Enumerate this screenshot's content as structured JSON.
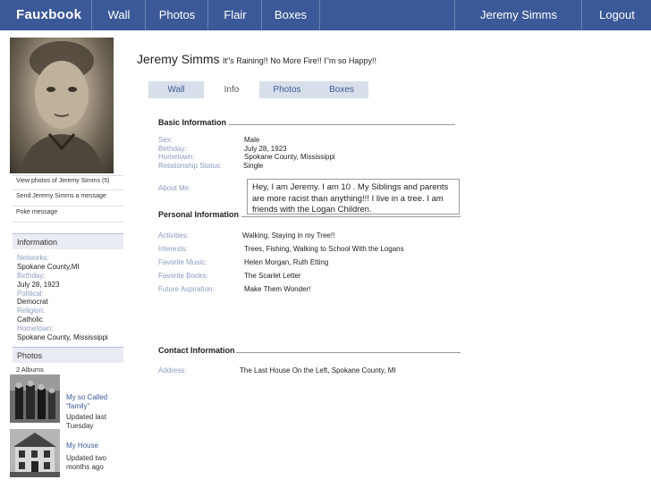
{
  "nav": {
    "brand": "Fauxbook",
    "items": [
      "Wall",
      "Photos",
      "Flair",
      "Boxes"
    ],
    "user": "Jeremy Simms",
    "logout": "Logout"
  },
  "profile": {
    "name": "Jeremy Simms",
    "status": "It\"s Raining!! No More Fire!! I\"m so Happy!!"
  },
  "tabs": [
    "Wall",
    "Info",
    "Photos",
    "Boxes"
  ],
  "active_tab": "Info",
  "left": {
    "actions": [
      "View photos of Jeremy Simms (5)",
      "Send Jeremy Simms a message",
      "Poke message"
    ],
    "information": {
      "header": "Information",
      "fields": [
        {
          "key": "Networks:",
          "value": "Spokane County,MI"
        },
        {
          "key": "Birthday:",
          "value": "July 28, 1923"
        },
        {
          "key": "Political:",
          "value": "Democrat"
        },
        {
          "key": "Religion:",
          "value": "Catholic"
        },
        {
          "key": "Hometown:",
          "value": "Spokane County, Mississippi"
        }
      ]
    },
    "photos": {
      "header": "Photos",
      "count": "2 Albums",
      "albums": [
        {
          "title": "My so Called “family”",
          "updated": "Updated last Tuesday"
        },
        {
          "title": "My House",
          "updated": "Updated two months ago"
        }
      ]
    }
  },
  "basic": {
    "header": "Basic Information",
    "fields": [
      {
        "key": "Sex:",
        "value": "Male"
      },
      {
        "key": "Birthday:",
        "value": "July 28, 1923"
      },
      {
        "key": "Hometown:",
        "value": "Spokane County, Mississippi"
      },
      {
        "key": "Relationship Status:",
        "value": "Single"
      }
    ],
    "about_key": "About Me:",
    "about_value": "Hey, I am Jeremy. I am 10 . My Siblings and parents are more racist than anything!!! I live in a tree. I am friends with the Logan Children."
  },
  "personal": {
    "header": "Personal Information",
    "fields": [
      {
        "key": "Activities:",
        "value": "Walking, Staying in my Tree!!"
      },
      {
        "key": "Interests:",
        "value": "Trees, Fishing, Walking to School With the Logans"
      },
      {
        "key": "Favorite Music:",
        "value": "Helen Morgan, Ruth Etting"
      },
      {
        "key": "Favorite Books:",
        "value": "The Scarlet Letter"
      },
      {
        "key": "Future  Aspiration:",
        "value": "Make Them Wonder!"
      }
    ]
  },
  "contact": {
    "header": "Contact Information",
    "address_key": "Address:",
    "address_value": "The Last House On the Left, Spokane County, MI"
  },
  "colors": {
    "topbar": "#3b5998",
    "link": "#3b5998",
    "label": "#8e9ac0",
    "tab_bg": "#d8dfea"
  }
}
